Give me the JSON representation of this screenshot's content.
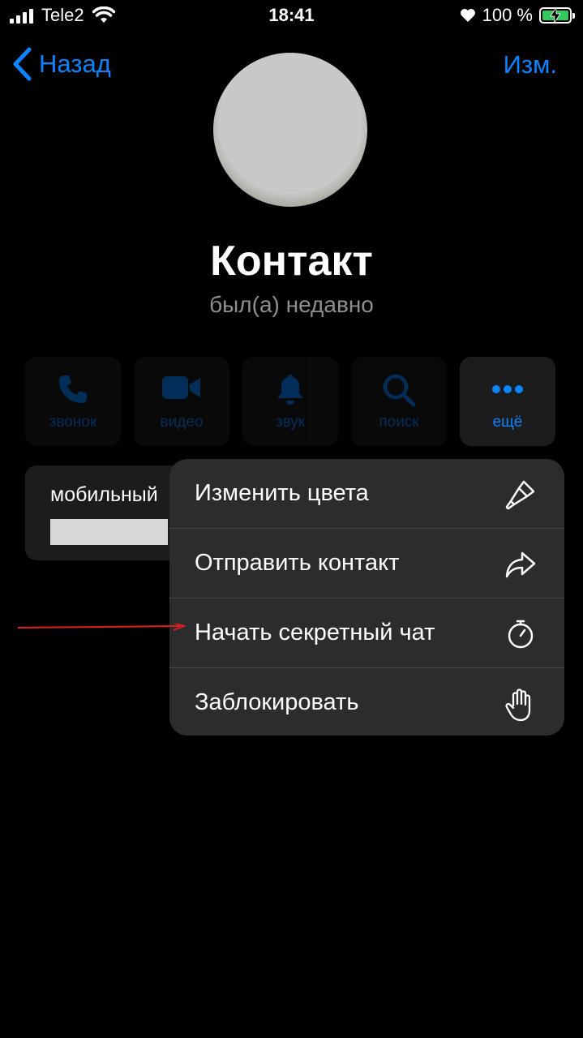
{
  "status_bar": {
    "carrier": "Tele2",
    "time": "18:41",
    "battery": "100 %"
  },
  "nav": {
    "back_label": "Назад",
    "edit_label": "Изм."
  },
  "profile": {
    "name": "Контакт",
    "last_seen": "был(а) недавно"
  },
  "actions": [
    {
      "label": "звонок",
      "icon": "phone-icon"
    },
    {
      "label": "видео",
      "icon": "video-icon"
    },
    {
      "label": "звук",
      "icon": "bell-icon"
    },
    {
      "label": "поиск",
      "icon": "search-icon"
    },
    {
      "label": "ещё",
      "icon": "more-icon"
    }
  ],
  "info_card": {
    "label": "мобильный"
  },
  "menu": {
    "items": [
      {
        "label": "Изменить цвета",
        "icon": "brush-icon"
      },
      {
        "label": "Отправить контакт",
        "icon": "share-icon"
      },
      {
        "label": "Начать секретный чат",
        "icon": "timer-icon"
      },
      {
        "label": "Заблокировать",
        "icon": "hand-icon"
      }
    ]
  },
  "colors": {
    "accent": "#0a84ff",
    "background": "#000000",
    "menu_bg": "#2c2c2e",
    "annotation_arrow": "#e0201f"
  }
}
